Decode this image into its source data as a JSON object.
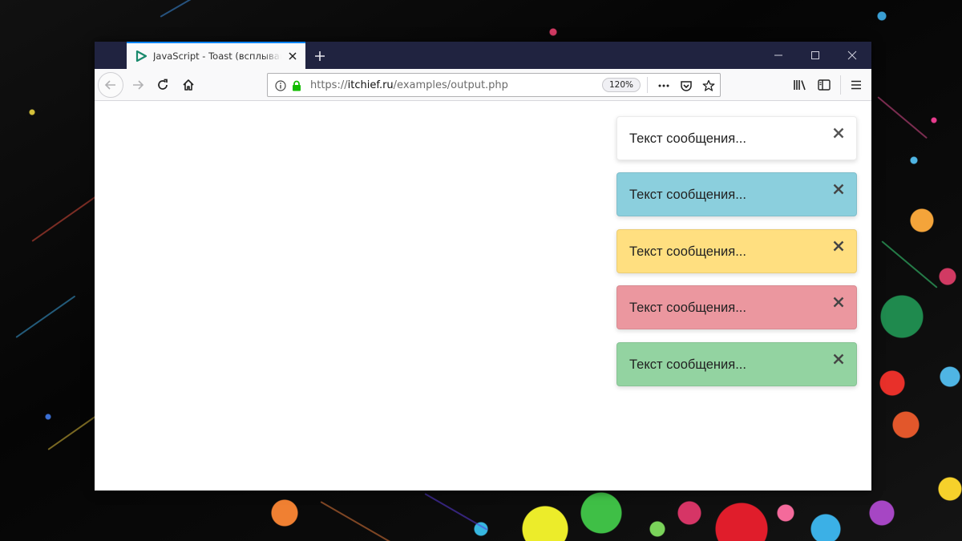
{
  "browser": {
    "tab": {
      "title": "JavaScript - Toast (всплывающие сообщения)",
      "favicon": "play-triangle-icon"
    },
    "new_tab_icon": "plus-icon",
    "window_controls": [
      "minimize-icon",
      "maximize-icon",
      "close-icon"
    ],
    "nav": {
      "back_icon": "arrow-left-icon",
      "forward_icon": "arrow-right-icon",
      "reload_icon": "reload-icon",
      "home_icon": "home-icon"
    },
    "url": {
      "scheme": "https://",
      "host": "itchief.ru",
      "path": "/examples/output.php",
      "zoom": "120%"
    },
    "toolbar_icons": [
      "page-actions-icon",
      "pocket-icon",
      "bookmark-star-icon",
      "library-icon",
      "sidebar-icon",
      "hamburger-menu-icon"
    ]
  },
  "toasts": [
    {
      "text": "Текст сообщения...",
      "bg": "#ffffff"
    },
    {
      "text": "Текст сообщения...",
      "bg": "#8bcfdd"
    },
    {
      "text": "Текст сообщения...",
      "bg": "#ffdf80"
    },
    {
      "text": "Текст сообщения...",
      "bg": "#eb979f"
    },
    {
      "text": "Текст сообщения...",
      "bg": "#93d3a1"
    }
  ],
  "colors": {
    "titlebar": "#202340",
    "tab_accent": "#0a84ff",
    "favicon": "#1a8a6d",
    "lock_green": "#12bc00"
  }
}
